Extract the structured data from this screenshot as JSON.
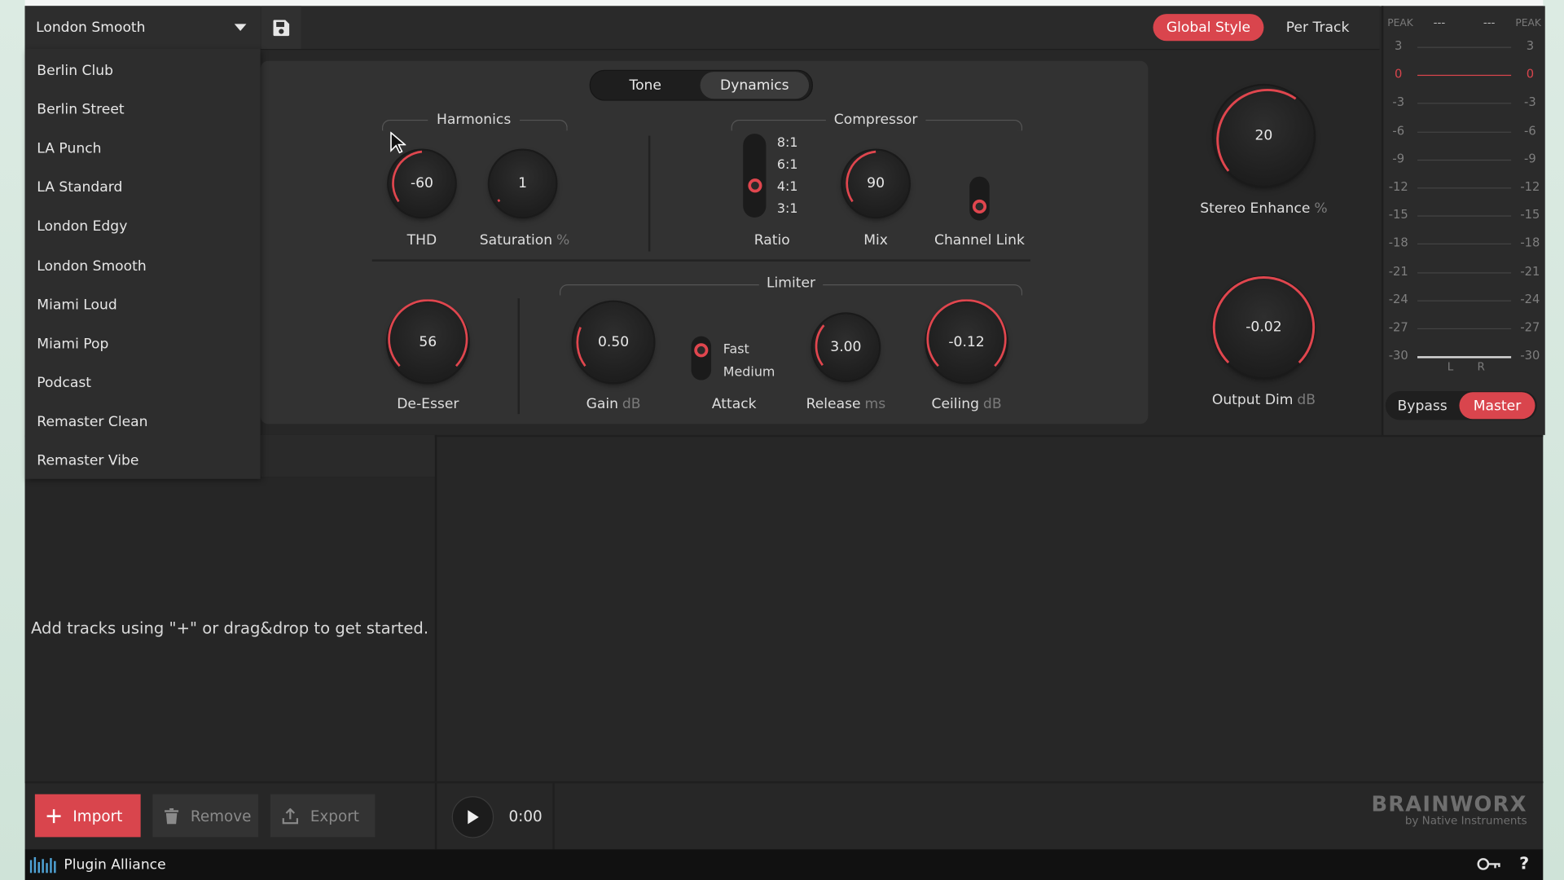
{
  "preset": {
    "selected": "London Smooth"
  },
  "dropdown_items": [
    "Berlin Club",
    "Berlin Street",
    "LA Punch",
    "LA Standard",
    "London Edgy",
    "London Smooth",
    "Miami Loud",
    "Miami Pop",
    "Podcast",
    "Remaster Clean",
    "Remaster Vibe"
  ],
  "mode_toggle": {
    "global_style": "Global Style",
    "per_track": "Per Track"
  },
  "tabs": {
    "tone": "Tone",
    "dynamics": "Dynamics"
  },
  "harmonics": {
    "title": "Harmonics",
    "thd": {
      "value": "-60",
      "label": "THD"
    },
    "saturation": {
      "value": "1",
      "label": "Saturation",
      "unit": "%"
    }
  },
  "compressor": {
    "title": "Compressor",
    "ratio_options": [
      "8:1",
      "6:1",
      "4:1",
      "3:1"
    ],
    "ratio_selected": "4:1",
    "ratio_label": "Ratio",
    "mix": {
      "value": "90",
      "label": "Mix"
    },
    "channel_link": {
      "label": "Channel Link"
    }
  },
  "deesser": {
    "value": "56",
    "label": "De-Esser"
  },
  "limiter": {
    "title": "Limiter",
    "gain": {
      "value": "0.50",
      "label": "Gain",
      "unit": "dB"
    },
    "attack": {
      "label": "Attack",
      "options": [
        "Fast",
        "Medium"
      ],
      "selected": "Fast"
    },
    "release": {
      "value": "3.00",
      "label": "Release",
      "unit": "ms"
    },
    "ceiling": {
      "value": "-0.12",
      "label": "Ceiling",
      "unit": "dB"
    }
  },
  "stereo_enhance": {
    "value": "20",
    "label": "Stereo Enhance",
    "unit": "%"
  },
  "output_dim": {
    "value": "-0.02",
    "label": "Output Dim",
    "unit": "dB"
  },
  "meter": {
    "peak_label": "PEAK",
    "left_peak": "---",
    "right_peak": "---",
    "scale": [
      "3",
      "0",
      "-3",
      "-6",
      "-9",
      "-12",
      "-15",
      "-18",
      "-21",
      "-24",
      "-27",
      "-30"
    ],
    "channel_l": "L",
    "channel_r": "R"
  },
  "bypass_toggle": {
    "bypass": "Bypass",
    "master": "Master"
  },
  "tracklist": {
    "empty_message": "Add tracks using \"+\" or drag&drop to get started."
  },
  "buttons": {
    "import": "Import",
    "remove": "Remove",
    "export": "Export"
  },
  "transport": {
    "time": "0:00"
  },
  "brand": {
    "name": "BRAINWORX",
    "tagline": "by Native Instruments"
  },
  "statusbar": {
    "product": "Plugin Alliance"
  },
  "colors": {
    "accent": "#d9454d",
    "background": "#272727",
    "panel": "#323232"
  }
}
